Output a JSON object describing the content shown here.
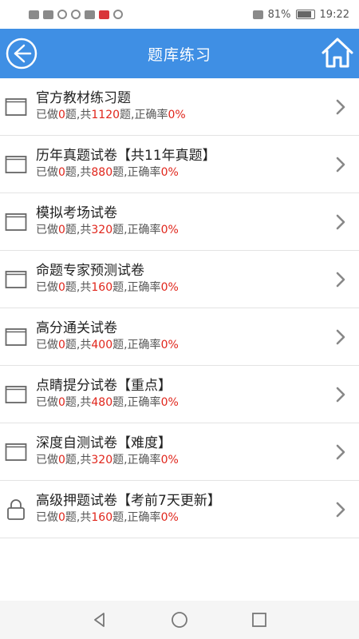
{
  "status": {
    "battery": "81%",
    "time": "19:22"
  },
  "header": {
    "title": "题库练习",
    "back_icon": "back-circle-arrow-icon",
    "home_icon": "home-icon",
    "bg_color": "#3f8fe4"
  },
  "items": [
    {
      "name": "官方教材练习题",
      "done_prefix": "已做",
      "done": "0",
      "total_prefix": "题,共",
      "total": "1120",
      "rate_prefix": "题,正确率",
      "rate": "0%",
      "icon": "folder-icon"
    },
    {
      "name": "历年真题试卷【共11年真题】",
      "done_prefix": "已做",
      "done": "0",
      "total_prefix": "题,共",
      "total": "880",
      "rate_prefix": "题,正确率",
      "rate": "0%",
      "icon": "folder-icon"
    },
    {
      "name": "模拟考场试卷",
      "done_prefix": "已做",
      "done": "0",
      "total_prefix": "题,共",
      "total": "320",
      "rate_prefix": "题,正确率",
      "rate": "0%",
      "icon": "folder-icon"
    },
    {
      "name": "命题专家预测试卷",
      "done_prefix": "已做",
      "done": "0",
      "total_prefix": "题,共",
      "total": "160",
      "rate_prefix": "题,正确率",
      "rate": "0%",
      "icon": "folder-icon"
    },
    {
      "name": "高分通关试卷",
      "done_prefix": "已做",
      "done": "0",
      "total_prefix": "题,共",
      "total": "400",
      "rate_prefix": "题,正确率",
      "rate": "0%",
      "icon": "folder-icon"
    },
    {
      "name": "点睛提分试卷【重点】",
      "done_prefix": "已做",
      "done": "0",
      "total_prefix": "题,共",
      "total": "480",
      "rate_prefix": "题,正确率",
      "rate": "0%",
      "icon": "folder-icon"
    },
    {
      "name": "深度自测试卷【难度】",
      "done_prefix": "已做",
      "done": "0",
      "total_prefix": "题,共",
      "total": "320",
      "rate_prefix": "题,正确率",
      "rate": "0%",
      "icon": "folder-icon"
    },
    {
      "name": "高级押题试卷【考前7天更新】",
      "done_prefix": "已做",
      "done": "0",
      "total_prefix": "题,共",
      "total": "160",
      "rate_prefix": "题,正确率",
      "rate": "0%",
      "icon": "lock-icon"
    }
  ],
  "colors": {
    "accent_number": "#e0251b",
    "header": "#3f8fe4"
  },
  "nav": {
    "icons": [
      "back-triangle-icon",
      "home-circle-icon",
      "recents-square-icon"
    ]
  }
}
